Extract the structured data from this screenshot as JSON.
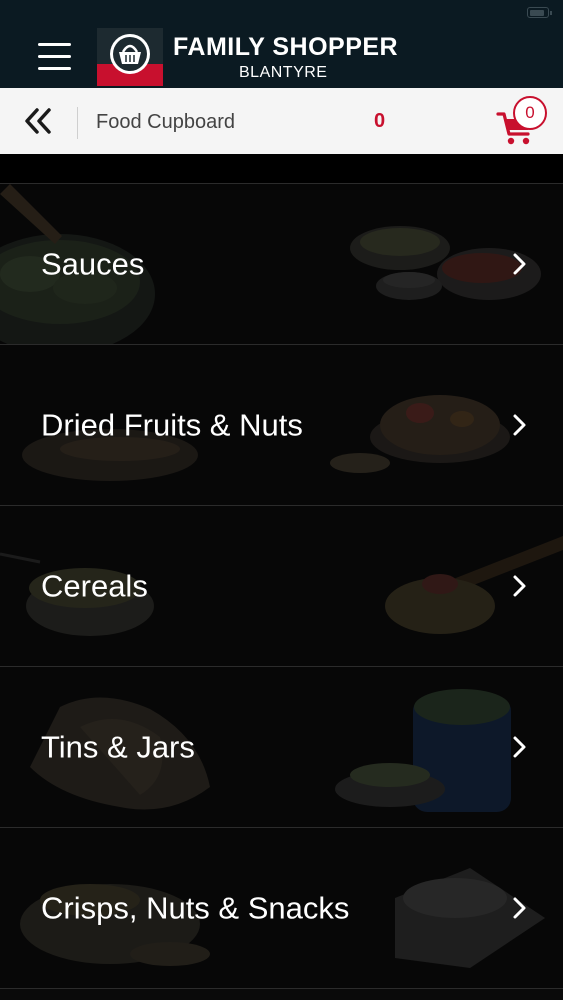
{
  "header": {
    "brand_name": "FAMILY SHOPPER",
    "brand_location": "BLANTYRE",
    "background_color": "#0b1a22",
    "brand_red": "#c8102e"
  },
  "sub_header": {
    "title": "Food Cupboard",
    "cart_total": "0",
    "cart_count": "0"
  },
  "categories": [
    {
      "label": "Sauces"
    },
    {
      "label": "Dried Fruits & Nuts"
    },
    {
      "label": "Cereals"
    },
    {
      "label": "Tins & Jars"
    },
    {
      "label": "Crisps, Nuts & Snacks"
    }
  ],
  "icons": {
    "menu": "hamburger-icon",
    "back": "double-chevron-left-icon",
    "cart": "shopping-cart-icon",
    "row": "chevron-right-icon"
  }
}
